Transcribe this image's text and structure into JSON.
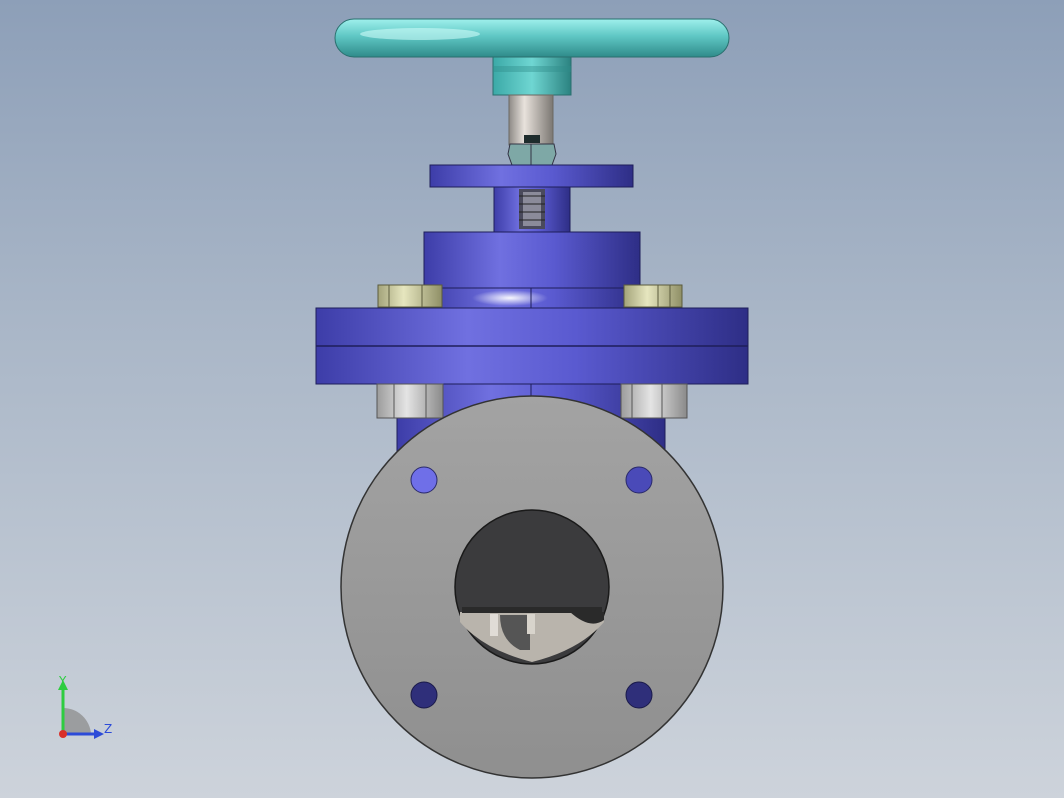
{
  "viewport": {
    "background_top": "#8d9fb8",
    "background_bottom": "#cdd3db"
  },
  "model": {
    "handwheel_color": "#5fc7c4",
    "body_color": "#5a5ad0",
    "flange_face_color": "#9a9a9a",
    "bolt_color": "#cfcfa2",
    "nut_color": "#c9c9c9"
  },
  "triad": {
    "y_label": "Y",
    "z_label": "Z",
    "y_color": "#2ecc40",
    "z_color": "#2c4bd8",
    "x_color": "#d9302a"
  }
}
